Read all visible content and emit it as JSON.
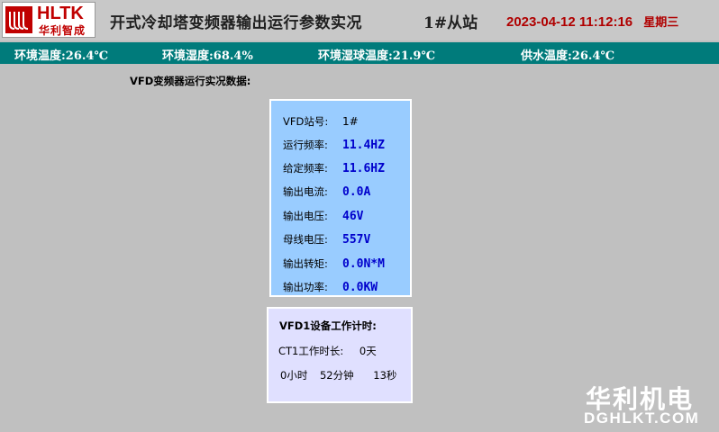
{
  "header": {
    "logo_text_top": "HLTK",
    "logo_text_bottom": "华利智成",
    "title": "开式冷却塔变频器输出运行参数实况",
    "station": "1#从站",
    "date": "2023-04-12",
    "time": "11:12:16",
    "weekday": "星期三",
    "datetime_color": "#b00000"
  },
  "env": {
    "bar_color": "#007b7b",
    "items": [
      "环境温度:26.4℃",
      "环境湿度:68.4%",
      "环境湿球温度:21.9℃",
      "供水温度:26.4℃"
    ]
  },
  "section_title": "VFD变频器运行实况数据:",
  "vfd": {
    "panel_color": "#99ccff",
    "rows": [
      {
        "label": "VFD站号:",
        "value": "1#"
      },
      {
        "label": "运行频率:",
        "value": "11.4HZ"
      },
      {
        "label": "给定频率:",
        "value": "11.6HZ"
      },
      {
        "label": "输出电流:",
        "value": "0.0A"
      },
      {
        "label": "输出电压:",
        "value": "46V"
      },
      {
        "label": "母线电压:",
        "value": "557V"
      },
      {
        "label": "输出转矩:",
        "value": "0.0N*M"
      },
      {
        "label": "输出功率:",
        "value": "0.0KW"
      }
    ]
  },
  "work_time": {
    "title": "VFD1设备工作计时:",
    "ct_label": "CT1工作时长:",
    "days": "0天",
    "hours": "0小时",
    "minutes": "52分钟",
    "seconds": "13秒"
  },
  "watermark": {
    "line1": "华利机电",
    "line2": "DGHLKT.COM"
  }
}
